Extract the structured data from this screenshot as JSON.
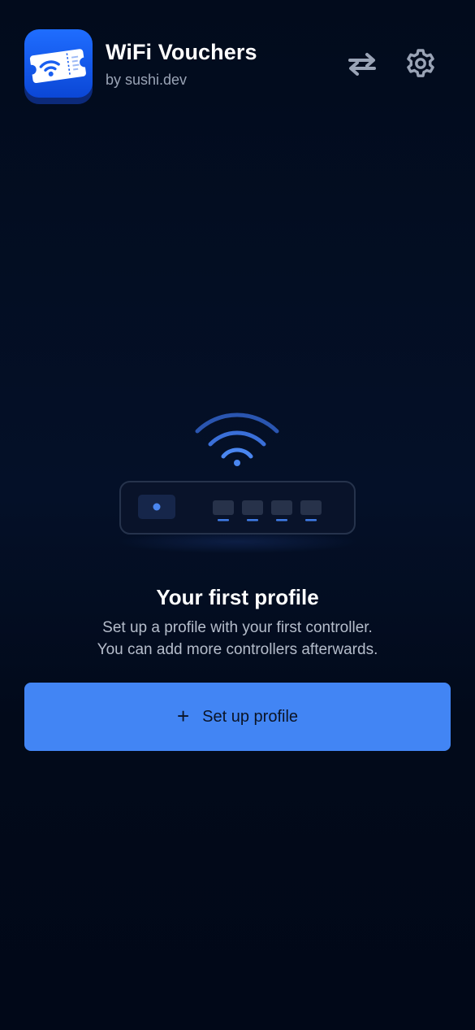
{
  "header": {
    "app_name": "WiFi Vouchers",
    "app_author": "by sushi.dev",
    "icons": {
      "app": "wifi-ticket-icon",
      "swap": "swap-arrows-icon",
      "settings": "gear-icon"
    }
  },
  "empty_state": {
    "illustration": "router-wifi-icon",
    "title": "Your first profile",
    "line1": "Set up a profile with your first controller.",
    "line2": "You can add more controllers afterwards.",
    "button_icon": "+",
    "button_label": "Set up profile"
  },
  "colors": {
    "background": "#020b1d",
    "accent": "#4285f4",
    "muted_text": "#9aa4b6"
  }
}
